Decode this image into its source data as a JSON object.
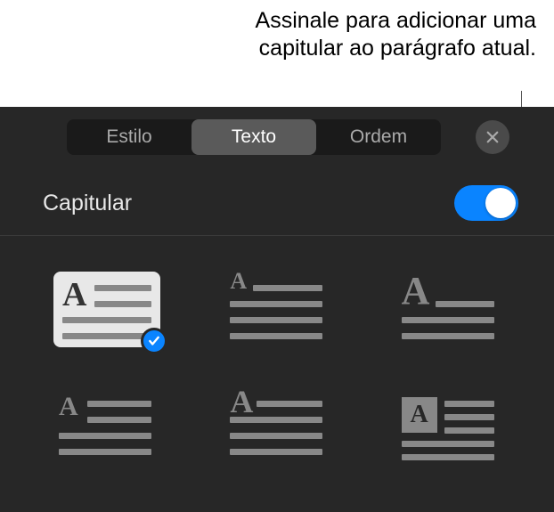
{
  "callout": {
    "text": "Assinale para adicionar uma capitular ao parágrafo atual."
  },
  "tabs": {
    "estilo": "Estilo",
    "texto": "Texto",
    "ordem": "Ordem"
  },
  "section": {
    "capitular_label": "Capitular"
  }
}
